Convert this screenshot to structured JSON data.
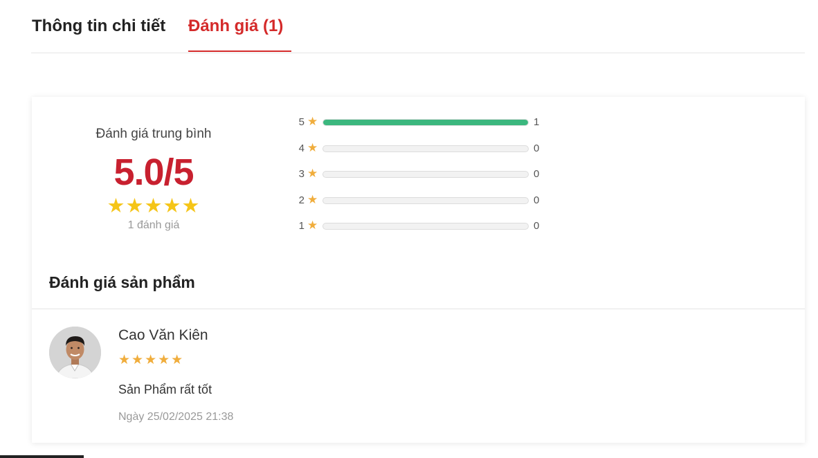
{
  "tabs": {
    "details_label": "Thông tin chi tiết",
    "reviews_label": "Đánh giá (1)",
    "active": "reviews"
  },
  "summary": {
    "average_label": "Đánh giá trung bình",
    "average_score": "5.0/5",
    "stars": "★★★★★",
    "total_count_text": "1 đánh giá"
  },
  "distribution": [
    {
      "stars": "5",
      "count": "1",
      "fraction": 1.0
    },
    {
      "stars": "4",
      "count": "0",
      "fraction": 0
    },
    {
      "stars": "3",
      "count": "0",
      "fraction": 0
    },
    {
      "stars": "2",
      "count": "0",
      "fraction": 0
    },
    {
      "stars": "1",
      "count": "0",
      "fraction": 0
    }
  ],
  "reviews_section": {
    "title": "Đánh giá sản phẩm"
  },
  "reviews": [
    {
      "author": "Cao Văn Kiên",
      "stars": "★★★★★",
      "text": "Sản Phẩm rất tốt",
      "date": "Ngày 25/02/2025 21:38"
    }
  ],
  "colors": {
    "accent_red": "#d42a2a",
    "score_red": "#c8202f",
    "bar_green": "#3bb77e",
    "star_gold": "#f5c518",
    "star_orange": "#f0ad3c"
  }
}
